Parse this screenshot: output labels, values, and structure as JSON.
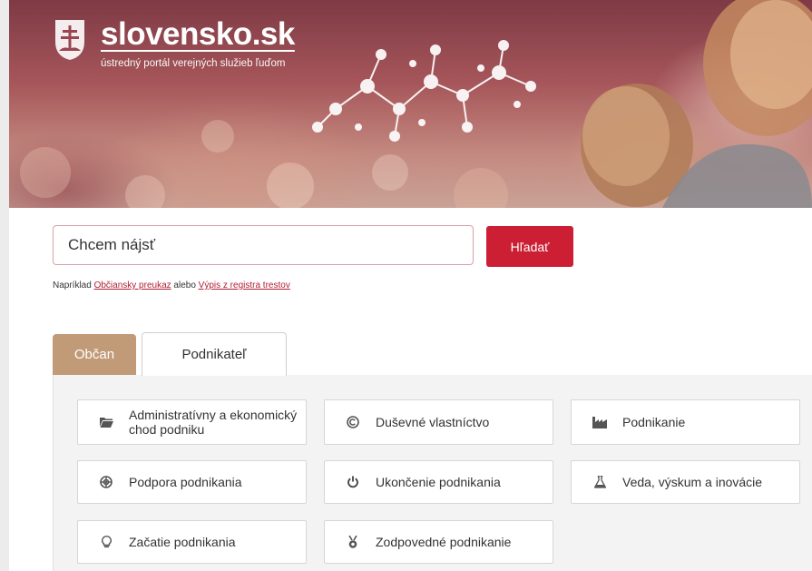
{
  "header": {
    "logo_title": "slovensko.sk",
    "logo_subtitle": "ústredný portál verejných služieb ľuďom"
  },
  "search": {
    "value": "Chcem nájsť",
    "button_label": "Hľadať",
    "hint_prefix": "Napríklad",
    "hint_link1": "Občiansky preukaz",
    "hint_middle": "alebo",
    "hint_link2": "Výpis z registra trestov"
  },
  "tabs": [
    {
      "label": "Občan",
      "active": false
    },
    {
      "label": "Podnikateľ",
      "active": true
    }
  ],
  "categories": [
    {
      "label": "Administratívny a ekonomický chod podniku",
      "icon": "folder-icon"
    },
    {
      "label": "Duševné vlastníctvo",
      "icon": "copyright-icon"
    },
    {
      "label": "Podnikanie",
      "icon": "factory-icon"
    },
    {
      "label": "Podpora podnikania",
      "icon": "lifebuoy-icon"
    },
    {
      "label": "Ukončenie podnikania",
      "icon": "power-icon"
    },
    {
      "label": "Veda, výskum a inovácie",
      "icon": "flask-icon"
    },
    {
      "label": "Začatie podnikania",
      "icon": "lightbulb-icon"
    },
    {
      "label": "Zodpovedné podnikanie",
      "icon": "medal-icon"
    }
  ],
  "colors": {
    "accent_red": "#cc1f33",
    "tab_inactive": "#c19a78"
  }
}
